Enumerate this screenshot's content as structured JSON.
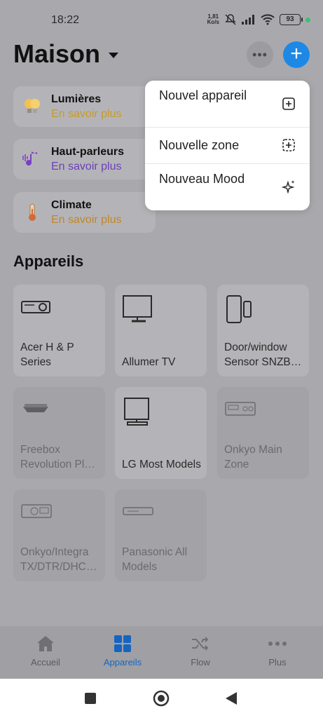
{
  "status": {
    "time": "18:22",
    "speed_top": "1,81",
    "speed_bottom": "Ko/s",
    "battery": "93"
  },
  "header": {
    "title": "Maison"
  },
  "categories": [
    {
      "label": "Lumières",
      "sub": "En savoir plus",
      "sub_color": "#c79a2a"
    },
    {
      "label": "Haut-parleurs",
      "sub": "En savoir plus",
      "sub_color": "#6d3fb8"
    },
    {
      "label": "Climate",
      "sub": "En savoir plus",
      "sub_color": "#c0862c"
    }
  ],
  "section_title": "Appareils",
  "devices": [
    {
      "label": "Acer H & P Series",
      "icon": "projector-icon"
    },
    {
      "label": "Allumer TV",
      "icon": "tv-icon"
    },
    {
      "label": "Door/window Sensor SNZB…",
      "icon": "door-sensor-icon"
    },
    {
      "label": "Freebox Revolution Pl…",
      "icon": "settop-box-icon"
    },
    {
      "label": "LG Most Models",
      "icon": "tv-icon"
    },
    {
      "label": "Onkyo Main Zone",
      "icon": "receiver-icon"
    },
    {
      "label": "Onkyo/Integra TX/DTR/DHC…",
      "icon": "amplifier-icon"
    },
    {
      "label": "Panasonic All Models",
      "icon": "bluray-player-icon"
    }
  ],
  "menu": [
    {
      "label": "Nouvel appareil",
      "icon": "plus-square-icon"
    },
    {
      "label": "Nouvelle zone",
      "icon": "dashed-plus-square-icon"
    },
    {
      "label": "Nouveau Mood",
      "icon": "sparkle-icon"
    }
  ],
  "nav": [
    {
      "label": "Accueil",
      "icon": "home-icon"
    },
    {
      "label": "Appareils",
      "icon": "grid-icon",
      "active": true
    },
    {
      "label": "Flow",
      "icon": "shuffle-icon"
    },
    {
      "label": "Plus",
      "icon": "dots-icon"
    }
  ],
  "colors": {
    "accent": "#1e88e5",
    "active_nav": "#1565c0"
  }
}
